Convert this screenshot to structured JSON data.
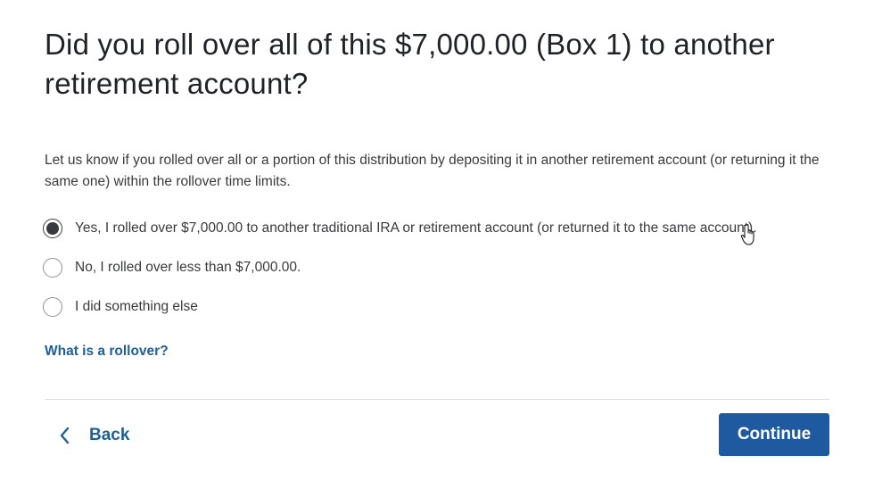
{
  "question": {
    "title": "Did you roll over all of this $7,000.00 (Box 1) to another retirement account?",
    "intro": "Let us know if you rolled over all or a portion of this distribution by depositing it in another retirement account (or returning it the same one) within the rollover time limits."
  },
  "options": [
    {
      "label": "Yes, I rolled over $7,000.00 to another traditional IRA or retirement account (or returned it to the same account).",
      "selected": true
    },
    {
      "label": "No, I rolled over less than $7,000.00.",
      "selected": false
    },
    {
      "label": "I did something else",
      "selected": false
    }
  ],
  "help_link": "What is a rollover?",
  "footer": {
    "back_label": "Back",
    "continue_label": "Continue"
  },
  "colors": {
    "accent": "#1f5aa0",
    "link": "#1d5f9a",
    "text": "#393a3d"
  }
}
